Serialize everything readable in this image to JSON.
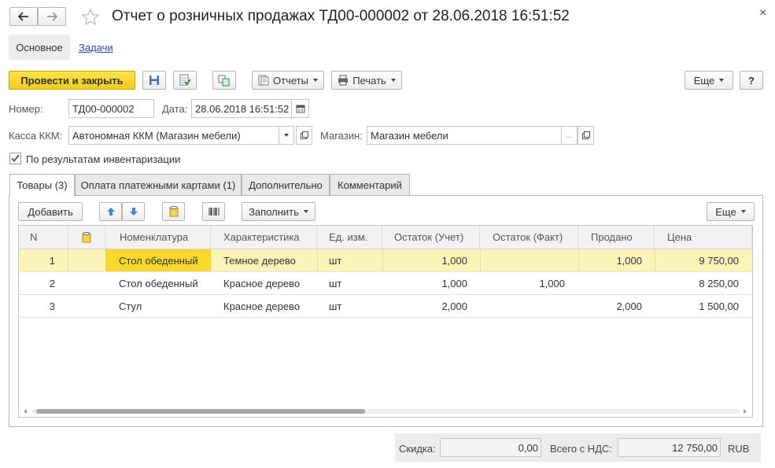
{
  "window": {
    "title": "Отчет о розничных продажах ТД00-000002 от 28.06.2018 16:51:52",
    "close_glyph": "×"
  },
  "nav_tabs": [
    {
      "label": "Основное"
    },
    {
      "label": "Задачи"
    }
  ],
  "toolbar": {
    "post_close_label": "Провести и закрыть",
    "reports_label": "Отчеты",
    "print_label": "Печать",
    "more_label": "Еще",
    "help_label": "?"
  },
  "header": {
    "number_label": "Номер:",
    "number_value": "ТД00-000002",
    "date_label": "Дата:",
    "date_value": "28.06.2018 16:51:52",
    "kkm_label": "Касса ККМ:",
    "kkm_value": "Автономная ККМ (Магазин мебели)",
    "store_label": "Магазин:",
    "store_value": "Магазин мебели",
    "store_ellipsis": "...",
    "inventory_label": "По результатам инвентаризации",
    "inventory_checked": true
  },
  "tabs": [
    {
      "label": "Товары (3)"
    },
    {
      "label": "Оплата платежными картами (1)"
    },
    {
      "label": "Дополнительно"
    },
    {
      "label": "Комментарий"
    }
  ],
  "table_toolbar": {
    "add_label": "Добавить",
    "fill_label": "Заполнить",
    "more_label": "Еще"
  },
  "table": {
    "columns": [
      "N",
      "Номенклатура",
      "Характеристика",
      "Ед. изм.",
      "Остаток (Учет)",
      "Остаток (Факт)",
      "Продано",
      "Цена"
    ],
    "rows": [
      {
        "n": "1",
        "item": "Стол обеденный",
        "char": "Темное дерево",
        "unit": "шт",
        "stock_acc": "1,000",
        "stock_fact": "",
        "sold": "1,000",
        "price": "9 750,00"
      },
      {
        "n": "2",
        "item": "Стол обеденный",
        "char": "Красное дерево",
        "unit": "шт",
        "stock_acc": "1,000",
        "stock_fact": "1,000",
        "sold": "",
        "price": "8 250,00"
      },
      {
        "n": "3",
        "item": "Стул",
        "char": "Красное дерево",
        "unit": "шт",
        "stock_acc": "2,000",
        "stock_fact": "",
        "sold": "2,000",
        "price": "1 500,00"
      }
    ]
  },
  "footer": {
    "discount_label": "Скидка:",
    "discount_value": "0,00",
    "total_label": "Всего с НДС:",
    "total_value": "12 750,00",
    "currency": "RUB"
  },
  "colors": {
    "accent_yellow": "#f5d327",
    "selected_row": "#fcf3b8",
    "selected_cell": "#f7d82b",
    "link": "#1f4fa3"
  }
}
